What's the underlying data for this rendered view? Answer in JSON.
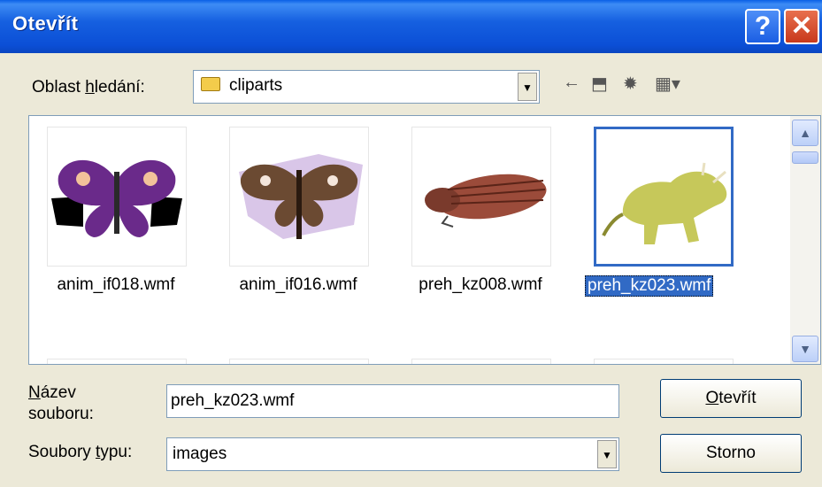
{
  "window": {
    "title": "Otevřít"
  },
  "lookin": {
    "label_prefix": "Oblast ",
    "label_underlined": "h",
    "label_suffix": "ledání:",
    "value": "cliparts"
  },
  "files": [
    {
      "name": "anim_if018.wmf",
      "icon": "butterfly-purple"
    },
    {
      "name": "anim_if016.wmf",
      "icon": "moth-brown"
    },
    {
      "name": "preh_kz008.wmf",
      "icon": "trilobite"
    },
    {
      "name": "preh_kz023.wmf",
      "icon": "triceratops",
      "selected": true
    }
  ],
  "filename": {
    "label_underlined": "N",
    "label_rest": "ázev",
    "label_line2": "souboru:",
    "value": "preh_kz023.wmf"
  },
  "filetype": {
    "label_prefix": "Soubory ",
    "label_underlined": "t",
    "label_suffix": "ypu:",
    "value": "images"
  },
  "buttons": {
    "open_underlined": "O",
    "open_rest": "tevřít",
    "cancel": "Storno"
  },
  "colors": {
    "titlebar": "#0a5fe6",
    "selection": "#316ac5",
    "dialog_bg": "#ece9d8"
  }
}
